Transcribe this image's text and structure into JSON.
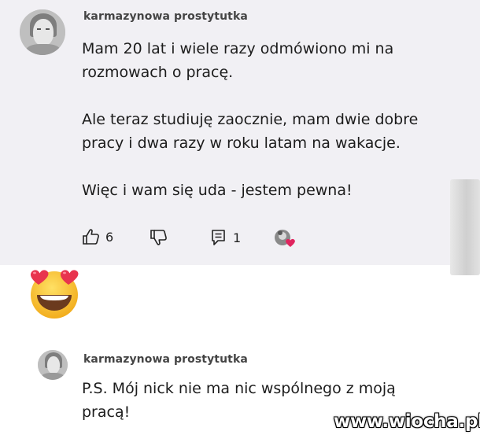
{
  "comment_1": {
    "author": "karmazynowa prostytutka",
    "text": "Mam 20 lat i wiele razy odmówiono mi na\nrozmowach o pracę.\n\nAle teraz studiuję zaocznie, mam dwie dobre\npracy i dwa razy w roku latam na wakacje.\n\nWięc i wam się uda - jestem pewna!",
    "like_count": "6",
    "reply_count": "1"
  },
  "comment_2": {
    "author": "karmazynowa prostytutka",
    "text": "P.S. Mój nick nie ma nic wspólnego z moją\npracą!"
  },
  "watermark": "www.wiocha.pl",
  "icons": {
    "like": "thumbs-up-icon",
    "dislike": "thumbs-down-icon",
    "reply": "comment-icon",
    "creator_heart": "creator-heart-avatar-icon",
    "emoji": "heart-eyes-emoji"
  },
  "colors": {
    "card_background": "#f1f0f4",
    "heart": "#e0245e",
    "emoji_face": "#f9c22e"
  }
}
